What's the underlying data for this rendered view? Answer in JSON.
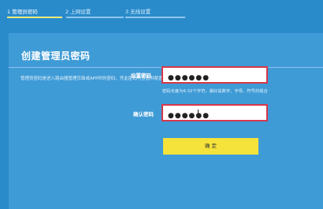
{
  "wizard": {
    "steps": [
      {
        "label": "1 管理员密码",
        "active": true
      },
      {
        "label": "2 上网设置",
        "active": false
      },
      {
        "label": "3 无线设置",
        "active": false
      }
    ]
  },
  "panel": {
    "title": "创建管理员密码",
    "description": "管理员密码是进入路由器管理页面或APP时的密码，凭此密码可查看并配置路由器的所有参数。"
  },
  "form": {
    "set_password_label": "设置密码",
    "set_password_value": "●●●●●●",
    "password_hint": "密码长度为6-32个字符，最好是数字、字母、符号的组合",
    "confirm_password_label": "确认密码",
    "confirm_password_value": "●●●●●●",
    "submit_label": "确 定"
  },
  "colors": {
    "background": "#2a8bcb",
    "panel": "#3f9bd6",
    "active_step_bar": "#f2eb7a",
    "input_border_highlight": "#d6374a",
    "button": "#f5e33b"
  }
}
